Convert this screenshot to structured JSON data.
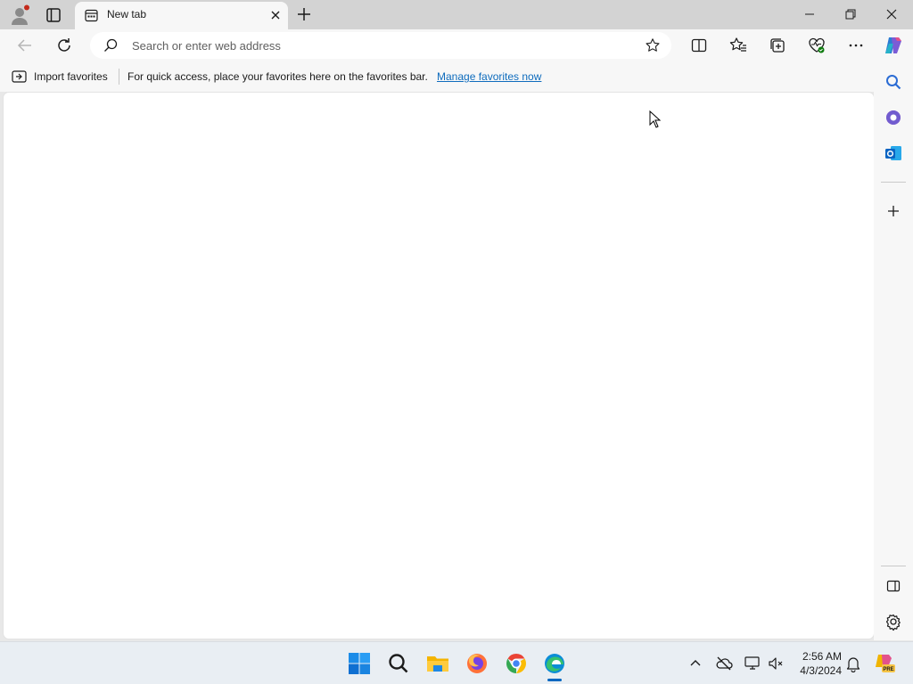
{
  "tab": {
    "title": "New tab"
  },
  "address_bar": {
    "value": "",
    "placeholder": "Search or enter web address"
  },
  "favorites_bar": {
    "import_label": "Import favorites",
    "message": "For quick access, place your favorites here on the favorites bar.",
    "link_label": "Manage favorites now"
  },
  "toolbar_icons": [
    "back-icon",
    "refresh-icon",
    "split-screen-icon",
    "favorites-icon",
    "collections-icon",
    "browser-essentials-icon",
    "more-icon",
    "copilot-icon"
  ],
  "sidebar_icons": [
    "search-icon",
    "office-icon",
    "outlook-icon",
    "add-icon",
    "hide-sidebar-icon",
    "settings-icon"
  ],
  "taskbar": {
    "apps": [
      "start-icon",
      "search-icon",
      "file-explorer-icon",
      "firefox-icon",
      "chrome-icon",
      "edge-icon"
    ],
    "clock": {
      "time": "2:56 AM",
      "date": "4/3/2024"
    },
    "pre_badge": "PRE"
  },
  "colors": {
    "accent": "#0f6cbd",
    "tabstrip": "#d3d3d3",
    "toolbar": "#f7f7f7"
  }
}
